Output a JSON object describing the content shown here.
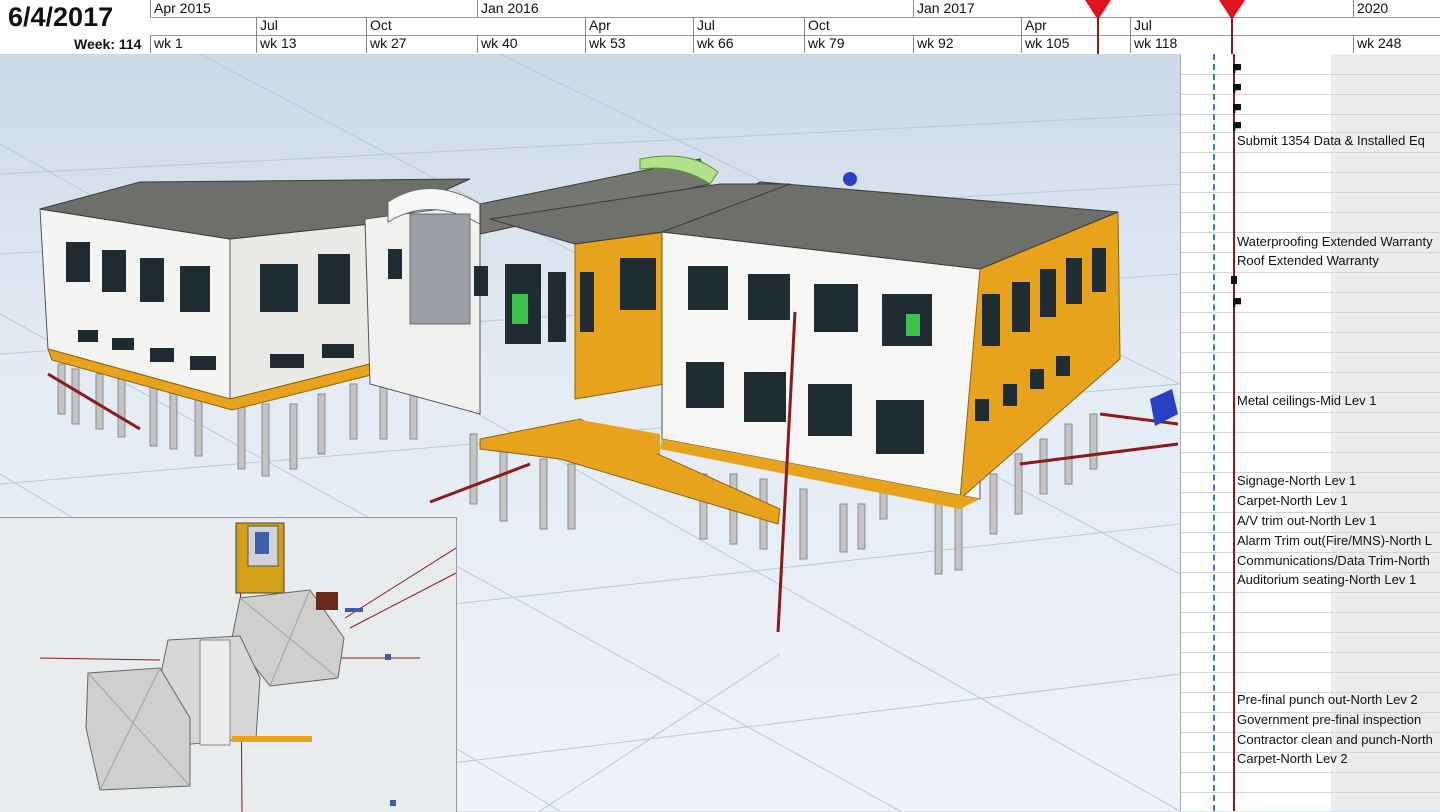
{
  "header": {
    "date": "6/4/2017",
    "week_label": "Week: 114"
  },
  "timeline": {
    "years": [
      "Apr 2015",
      "Jan 2016",
      "Jan 2017",
      "2020"
    ],
    "months": [
      "Jul",
      "Oct",
      "Apr",
      "Jul",
      "Oct",
      "Apr",
      "Jul"
    ],
    "weeks": [
      "wk 1",
      "wk 13",
      "wk 27",
      "wk 40",
      "wk 53",
      "wk 66",
      "wk 79",
      "wk 92",
      "wk 105",
      "wk 118",
      "wk 248"
    ],
    "marker_color": "#e0141e"
  },
  "gantt": {
    "tasks": [
      "Submit 1354 Data & Installed Eq",
      "Waterproofing Extended Warranty",
      "Roof Extended Warranty",
      "Metal ceilings-Mid Lev 1",
      "Signage-North Lev 1",
      "Carpet-North Lev 1",
      "A/V trim out-North Lev 1",
      "Alarm Trim out(Fire/MNS)-North L",
      "Communications/Data Trim-North",
      "Auditorium seating-North Lev 1",
      "Pre-final punch out-North Lev 2",
      "Government pre-final inspection",
      "Contractor clean and punch-North",
      "Carpet-North Lev 2"
    ]
  },
  "colors": {
    "building_white": "#f4f4f2",
    "building_yellow": "#e8a31c",
    "roof": "#6c6f6a",
    "window": "#1f2d33",
    "crane_red": "#8a1c1c",
    "today_blue": "#2a7fd4"
  }
}
